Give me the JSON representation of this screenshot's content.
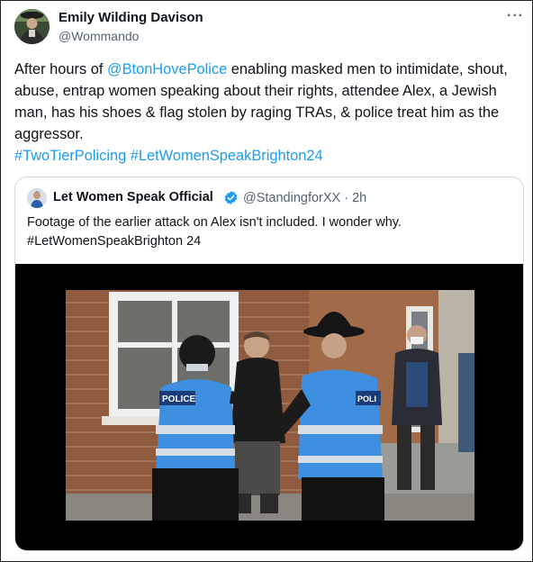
{
  "tweet": {
    "author_name": "Emily Wilding Davison",
    "author_handle": "@Wommando",
    "more_label": "···",
    "text_before_mention": "After hours of ",
    "mention": "@BtonHovePolice",
    "text_after_mention": " enabling masked men to intimidate, shout, abuse, entrap women speaking about their rights, attendee Alex, a Jewish man, has his shoes & flag stolen by raging TRAs, & police treat him as the aggressor.",
    "hashtags": [
      "#TwoTierPolicing",
      "#LetWomenSpeakBrighton24"
    ]
  },
  "quoted_tweet": {
    "author_name": "Let Women Speak Official",
    "author_handle": "@StandingforXX · 2h",
    "line1": "Footage of the earlier attack on Alex isn't included. I wonder why.",
    "line2": "#LetWomenSpeakBrighton 24",
    "video": {
      "vest_text_left": "POLICE",
      "vest_text_right": "POLI"
    }
  },
  "icons": {
    "verified": "verified-badge-icon",
    "more": "more-options-icon"
  },
  "colors": {
    "link": "#1d9bf0",
    "secondary_text": "#536471",
    "verified": "#1d9bf0",
    "hi_vis_blue": "#3f8fe0"
  }
}
